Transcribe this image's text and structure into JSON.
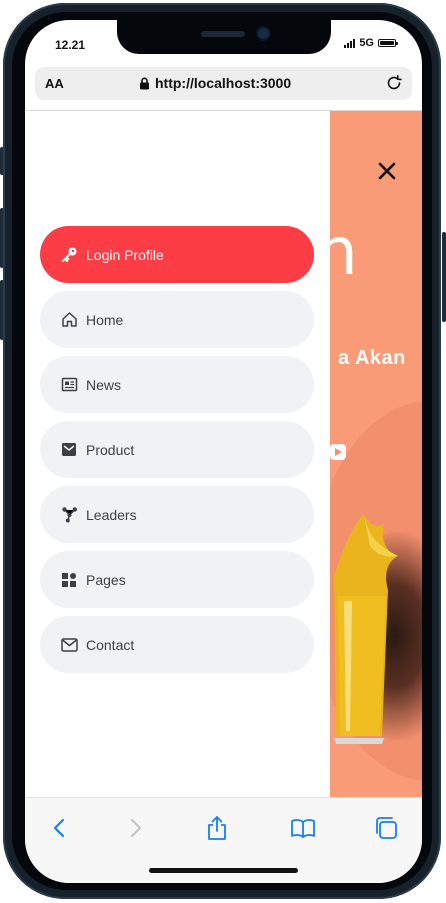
{
  "status_bar": {
    "time": "12.21",
    "network": "5G"
  },
  "browser": {
    "aa_label": "AA",
    "url": "http://localhost:3000"
  },
  "menu": {
    "items": [
      {
        "label": "Login Profile",
        "icon": "key-icon",
        "active": true
      },
      {
        "label": "Home",
        "icon": "home-icon",
        "active": false
      },
      {
        "label": "News",
        "icon": "newspaper-icon",
        "active": false
      },
      {
        "label": "Product",
        "icon": "envelope-box-icon",
        "active": false
      },
      {
        "label": "Leaders",
        "icon": "network-icon",
        "active": false
      },
      {
        "label": "Pages",
        "icon": "grid-icon",
        "active": false
      },
      {
        "label": "Contact",
        "icon": "mail-icon",
        "active": false
      }
    ]
  },
  "background": {
    "heading_glyph": "n",
    "subtitle": "a Akan"
  },
  "colors": {
    "active": "#fc3d46",
    "item_bg": "#f1f2f4",
    "background_panel": "#f99b77",
    "ios_blue": "#1a7cf6"
  }
}
